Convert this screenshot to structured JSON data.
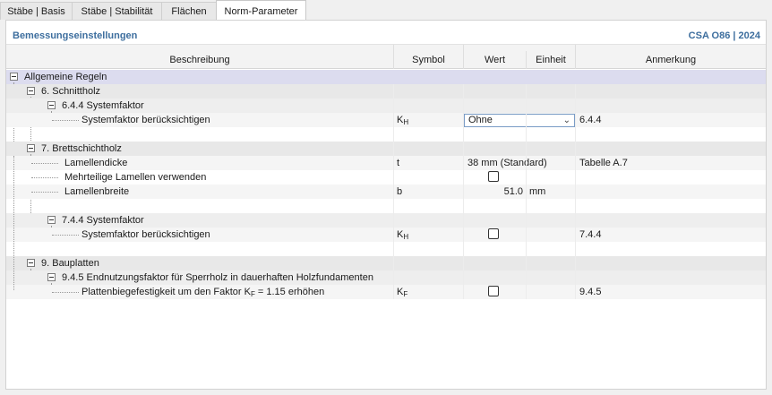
{
  "tabs": [
    {
      "label": "Stäbe | Basis",
      "active": false
    },
    {
      "label": "Stäbe | Stabilität",
      "active": false
    },
    {
      "label": "Flächen",
      "active": false
    },
    {
      "label": "Norm-Parameter",
      "active": true
    }
  ],
  "section": {
    "title": "Bemessungseinstellungen",
    "standard": "CSA O86 | 2024"
  },
  "columns": {
    "description": "Beschreibung",
    "symbol": "Symbol",
    "value": "Wert",
    "unit": "Einheit",
    "note": "Anmerkung"
  },
  "rows": {
    "general": {
      "label": "Allgemeine Regeln"
    },
    "sawn": {
      "label": "6. Schnittholz"
    },
    "sawn_sf": {
      "label": "6.4.4 Systemfaktor"
    },
    "sawn_sf_consider": {
      "label": "Systemfaktor berücksichtigen",
      "symbol_main": "K",
      "symbol_sub": "H",
      "value": "Ohne",
      "note": "6.4.4"
    },
    "glulam": {
      "label": "7. Brettschichtholz"
    },
    "lam_thickness": {
      "label": "Lamellendicke",
      "symbol": "t",
      "value": "38 mm (Standard)",
      "note": "Tabelle A.7"
    },
    "multi_lam": {
      "label": "Mehrteilige Lamellen verwenden",
      "checked": false
    },
    "lam_width": {
      "label": "Lamellenbreite",
      "symbol": "b",
      "value": "51.0",
      "unit": "mm"
    },
    "glulam_sf": {
      "label": "7.4.4 Systemfaktor"
    },
    "glulam_sf_consider": {
      "label": "Systemfaktor berücksichtigen",
      "symbol_main": "K",
      "symbol_sub": "H",
      "checked": false,
      "note": "7.4.4"
    },
    "panels": {
      "label": "9. Bauplatten"
    },
    "panels_factor": {
      "label": "9.4.5 Endnutzungsfaktor für Sperrholz in dauerhaften Holzfundamenten"
    },
    "panels_increase": {
      "label_pre": "Plattenbiegefestigkeit um den Faktor K",
      "label_sub": "F",
      "label_post": " = 1.15 erhöhen",
      "symbol_main": "K",
      "symbol_sub": "F",
      "checked": false,
      "note": "9.4.5"
    }
  }
}
